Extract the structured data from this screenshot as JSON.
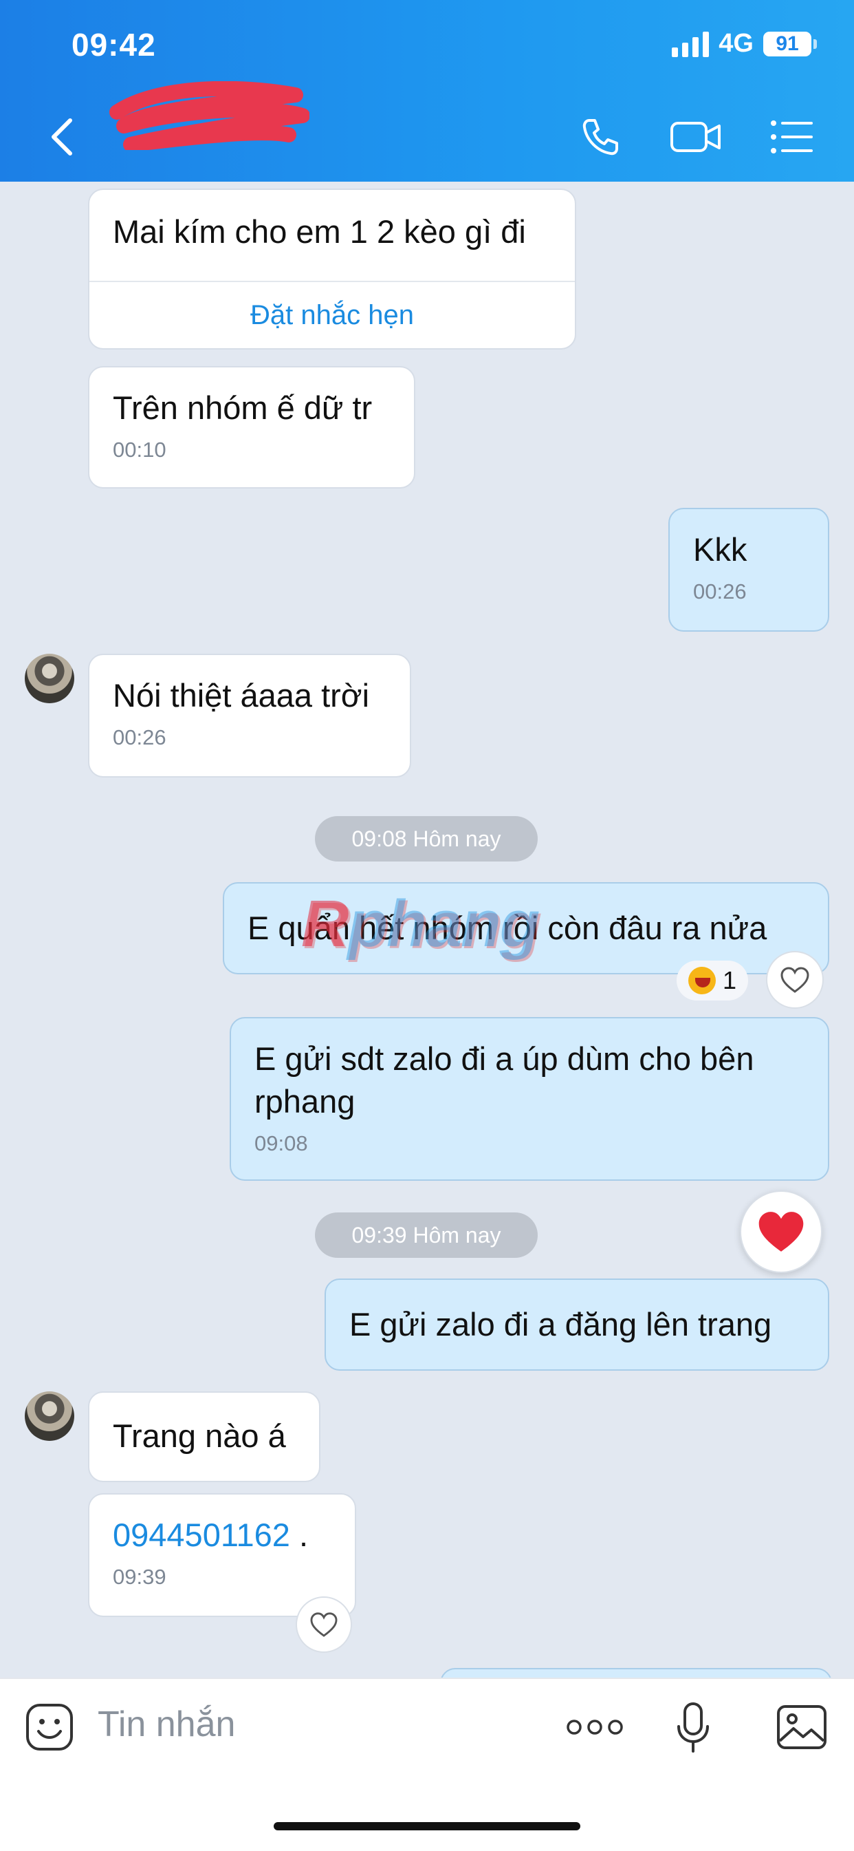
{
  "status_bar": {
    "time": "09:42",
    "network": "4G",
    "battery": "91"
  },
  "header": {
    "contact_name": ""
  },
  "messages": [
    {
      "id": "m1",
      "side": "in",
      "text": "Mai kím cho em 1 2 kèo gì đi",
      "action": "Đặt nhắc hẹn"
    },
    {
      "id": "m2",
      "side": "in",
      "text": "Trên nhóm ế dữ tr",
      "time": "00:10"
    },
    {
      "id": "m3",
      "side": "out",
      "text": "Kkk",
      "time": "00:26"
    },
    {
      "id": "m4",
      "side": "in",
      "text": "Nói thiệt áaaa trời",
      "time": "00:26"
    },
    {
      "id": "sep1",
      "type": "separator",
      "text": "09:08 Hôm nay"
    },
    {
      "id": "m5",
      "side": "out",
      "text": "E quẩn hết nhóm rồi còn đâu ra nửa",
      "reaction_count": "1"
    },
    {
      "id": "m6",
      "side": "out",
      "text": "E gửi sdt zalo đi a úp dùm cho bên rphang",
      "time": "09:08"
    },
    {
      "id": "sep2",
      "type": "separator",
      "text": "09:39 Hôm nay"
    },
    {
      "id": "m7",
      "side": "out",
      "text": "E gửi zalo đi a đăng lên trang"
    },
    {
      "id": "m8",
      "side": "in",
      "text": "Trang nào á"
    },
    {
      "id": "m9",
      "side": "in",
      "phone": "0944501162",
      "suffix": " .",
      "time": "09:39"
    }
  ],
  "watermark": {
    "first": "R",
    "rest": "phang"
  },
  "composer": {
    "placeholder": "Tin nhắn"
  },
  "colors": {
    "header_blue": "#1c86ea",
    "out_bubble": "#d3ecfd",
    "background": "#e2e8f1",
    "link": "#1a8be0",
    "heart": "#e8283a"
  }
}
